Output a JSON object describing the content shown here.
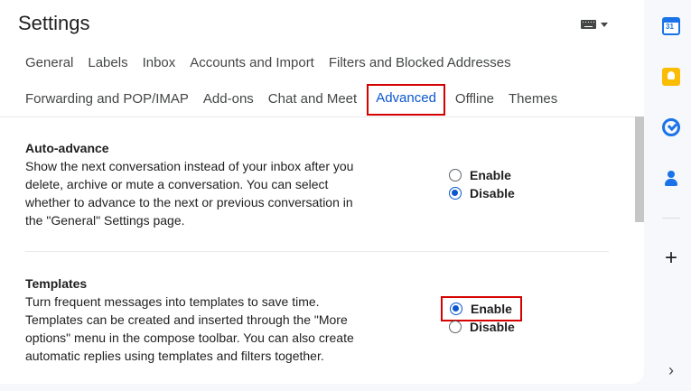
{
  "header": {
    "title": "Settings"
  },
  "tabs_row1": [
    {
      "label": "General"
    },
    {
      "label": "Labels"
    },
    {
      "label": "Inbox"
    },
    {
      "label": "Accounts and Import"
    },
    {
      "label": "Filters and Blocked Addresses"
    }
  ],
  "tabs_row2": [
    {
      "label": "Forwarding and POP/IMAP"
    },
    {
      "label": "Add-ons"
    },
    {
      "label": "Chat and Meet"
    },
    {
      "label": "Advanced",
      "active": true
    },
    {
      "label": "Offline"
    },
    {
      "label": "Themes"
    }
  ],
  "sections": [
    {
      "heading": "Auto-advance",
      "desc_lines": [
        "Show the next conversation instead of your inbox after you",
        "delete, archive or mute a conversation. You can select",
        "whether to advance to the next or previous conversation in",
        "the \"General\" Settings page."
      ],
      "options": [
        {
          "label": "Enable",
          "checked": false
        },
        {
          "label": "Disable",
          "checked": true
        }
      ]
    },
    {
      "heading": "Templates",
      "desc_lines": [
        "Turn frequent messages into templates to save time.",
        "Templates can be created and inserted through the \"More",
        "options\" menu in the compose toolbar. You can also create",
        "automatic replies using templates and filters together."
      ],
      "options": [
        {
          "label": "Enable",
          "checked": true
        },
        {
          "label": "Disable",
          "checked": false
        }
      ]
    }
  ],
  "side_rail": {
    "calendar_day": "31",
    "icons": [
      "calendar-icon",
      "keep-icon",
      "tasks-icon",
      "contacts-icon",
      "plus-icon",
      "chevron-right-icon"
    ],
    "plus_glyph": "+",
    "chevron_glyph": "›"
  },
  "colors": {
    "accent": "#0b57d0",
    "highlight_box": "#d50000"
  }
}
